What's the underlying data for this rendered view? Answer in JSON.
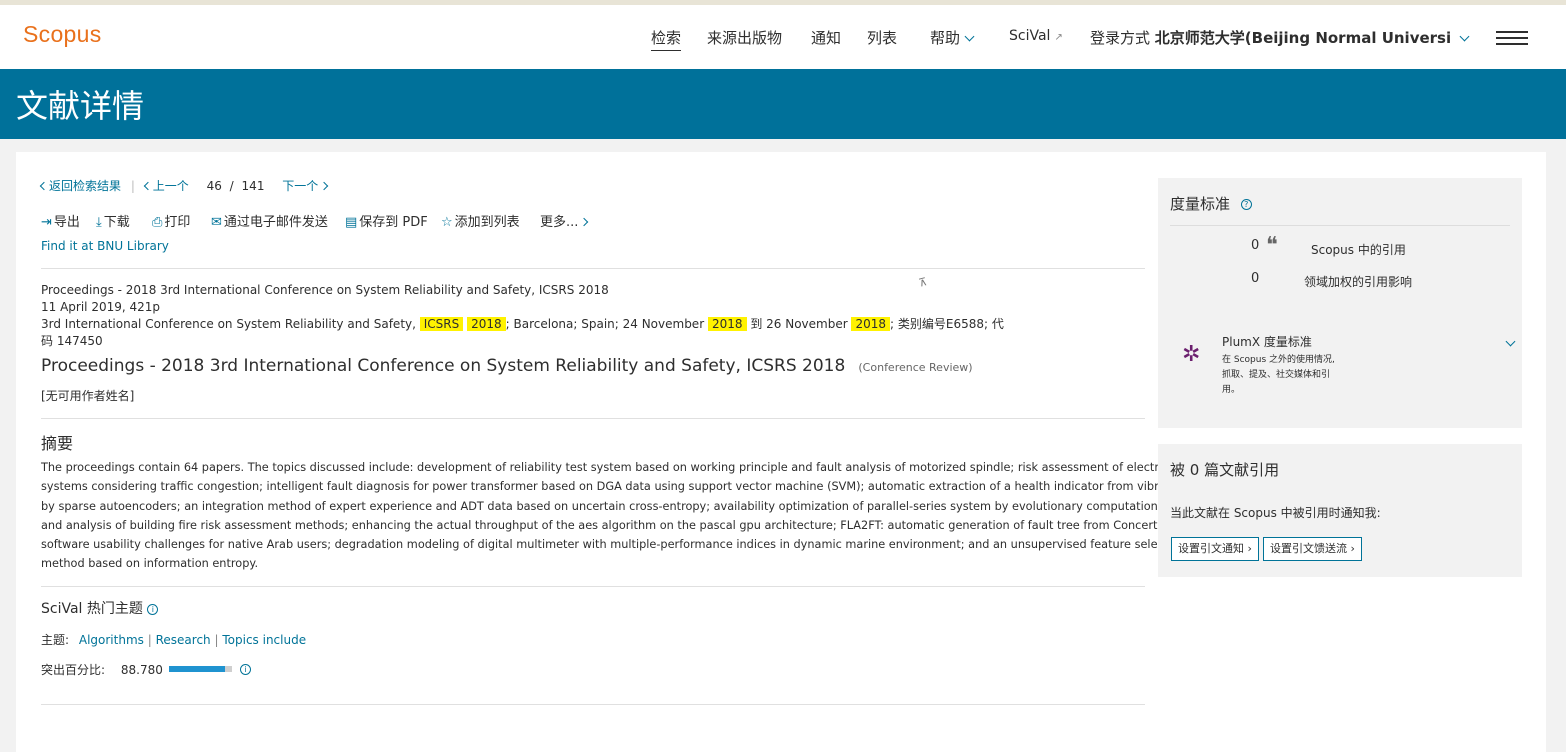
{
  "header": {
    "logo": "Scopus",
    "nav": [
      "检索",
      "来源出版物",
      "通知",
      "列表",
      "帮助",
      "SciVal"
    ],
    "login_prefix": "登录方式",
    "login_institution": "北京师范大学(Beijing Normal Universi"
  },
  "banner": {
    "title": "文献详情"
  },
  "navigation": {
    "back": "返回检索结果",
    "prev": "上一个",
    "current": "46",
    "sep": "/",
    "total": "141",
    "next": "下一个"
  },
  "toolbar": {
    "export": "导出",
    "download": "下载",
    "print": "打印",
    "email": "通过电子邮件发送",
    "save_pdf": "保存到 PDF",
    "add_list": "添加到列表",
    "more": "更多..."
  },
  "library_link": "Find it at BNU Library",
  "document": {
    "source_title": "Proceedings - 2018 3rd International Conference on System Reliability and Safety, ICSRS 2018",
    "date_pages": "11 April 2019, 421p",
    "conference": {
      "part1": "3rd International Conference on System Reliability and Safety,",
      "hl1": "ICSRS",
      "hl2": "2018",
      "part2": "; Barcelona; Spain; 24 November",
      "hl3": "2018",
      "part3": "到 26 November",
      "hl4": "2018",
      "part4": "; 类别编号E6588; 代",
      "line2": "码 147450"
    },
    "title": "Proceedings - 2018 3rd International Conference on System Reliability and Safety, ICSRS 2018",
    "doc_type": "(Conference Review)",
    "authors": "[无可用作者姓名]"
  },
  "abstract": {
    "heading": "摘要",
    "lines": [
      "The proceedings contain 64 papers. The topics discussed include: development of reliability test system based on working principle and fault analysis of motorized spindle; risk assessment of electrical power",
      "systems considering traffic congestion; intelligent fault diagnosis for power transformer based on DGA data using support vector machine (SVM); automatic extraction of a health indicator from vibrational data",
      "by sparse autoencoders; an integration method of expert experience and ADT data based on uncertain cross-entropy; availability optimization of parallel-series system by evolutionary computation; comparison",
      "and analysis of building fire risk assessment methods; enhancing the actual throughput of the aes algorithm on the pascal gpu architecture; FLA2FT: automatic generation of fault tree from ConcertoFLA results;",
      "software usability challenges for native Arab users; degradation modeling of digital multimeter with multiple-performance indices in dynamic marine environment; and an unsupervised feature selection",
      "method based on information entropy."
    ]
  },
  "scival": {
    "heading": "SciVal 热门主题",
    "topics_label": "主题:",
    "topics": [
      "Algorithms",
      "Research",
      "Topics include"
    ],
    "topic_sep": "|",
    "percentile_label": "突出百分比:",
    "percentile_value": "88.780",
    "percentile_fraction": 0.888
  },
  "metrics": {
    "heading": "度量标准",
    "scopus_citations_value": "0",
    "scopus_citations_label": "Scopus 中的引用",
    "fwci_value": "0",
    "fwci_label": "领域加权的引用影响",
    "plumx_title": "PlumX 度量标准",
    "plumx_desc": [
      "在 Scopus 之外的使用情况,",
      "抓取、提及、社交媒体和引",
      "用。"
    ]
  },
  "cited_by": {
    "heading": "被 0 篇文献引用",
    "notify_text": "当此文献在 Scopus 中被引用时通知我:",
    "btn_alert": "设置引文通知",
    "btn_feed": "设置引文馈送流"
  },
  "colors": {
    "brand_orange": "#e9711c",
    "banner_blue": "#00719a",
    "link": "#007398",
    "highlight": "#fff200",
    "plumx_purple": "#6b1f6e"
  },
  "icons": [
    "export-icon",
    "download-icon",
    "print-icon",
    "email-icon",
    "pdf-icon",
    "star-icon",
    "quote-icon",
    "plumx-icon",
    "info-icon",
    "menu-icon"
  ]
}
